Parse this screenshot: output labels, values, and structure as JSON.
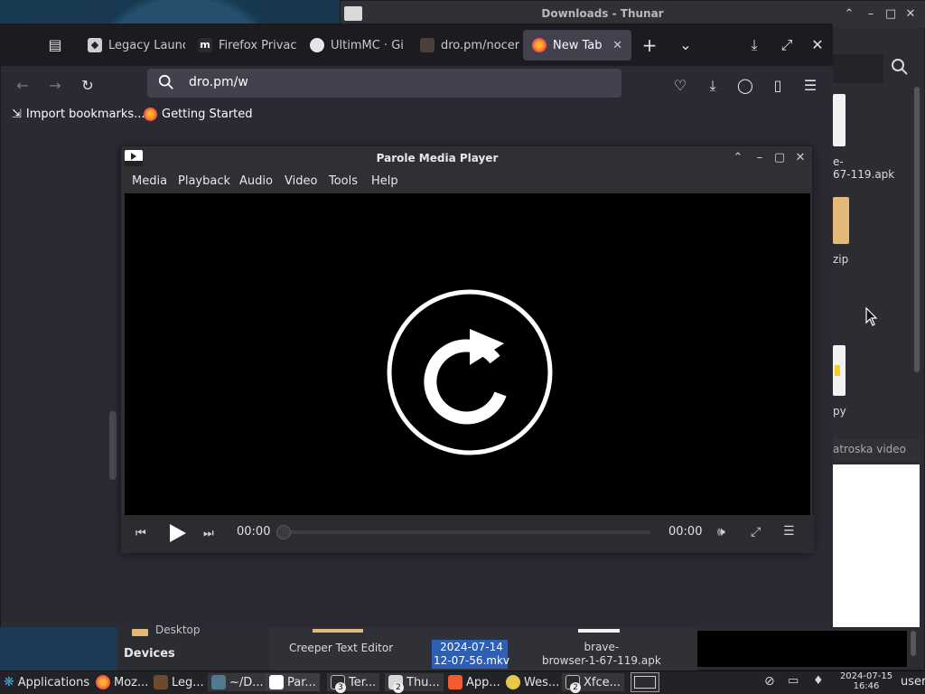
{
  "thunar": {
    "title": "Downloads - Thunar",
    "files": [
      {
        "label": "e-\n67-119.apk"
      },
      {
        "label": "zip"
      },
      {
        "label": "py"
      }
    ],
    "status": "atroska video",
    "lower_items": [
      {
        "label": "Desktop"
      },
      {
        "label": "Devices"
      },
      {
        "label": "Creeper Text Editor"
      },
      {
        "label": "2024-07-14\n12-07-56.mkv"
      },
      {
        "label": "brave-\nbrowser-1-67-119.apk"
      }
    ]
  },
  "firefox": {
    "tabs": [
      {
        "label": "Legacy Launc"
      },
      {
        "label": "Firefox Privac"
      },
      {
        "label": "UltimMC · Gi"
      },
      {
        "label": "dro.pm/nocer"
      },
      {
        "label": "New Tab"
      }
    ],
    "url": "dro.pm/w",
    "bookmarks": [
      {
        "label": "Import bookmarks..."
      },
      {
        "label": "Getting Started"
      }
    ]
  },
  "parole": {
    "title": "Parole Media Player",
    "menu": [
      "Media",
      "Playback",
      "Audio",
      "Video",
      "Tools",
      "Help"
    ],
    "time_elapsed": "00:00",
    "time_total": "00:00",
    "progress": 0
  },
  "taskbar": {
    "applications_label": "Applications",
    "tasks": [
      {
        "label": "Moz..."
      },
      {
        "label": "Leg..."
      },
      {
        "label": "~/D..."
      },
      {
        "label": "Par..."
      },
      {
        "label": "Ter...",
        "badge": "3"
      },
      {
        "label": "Thu...",
        "badge": "2"
      },
      {
        "label": "App..."
      },
      {
        "label": "Wes..."
      },
      {
        "label": "Xfce...",
        "badge": "2"
      }
    ],
    "date": "2024-07-15",
    "time": "16:46",
    "user": "user"
  },
  "colors": {
    "accent": "#3d6ab5",
    "selection": "#2d5fb4",
    "video_bg": "#000000"
  }
}
